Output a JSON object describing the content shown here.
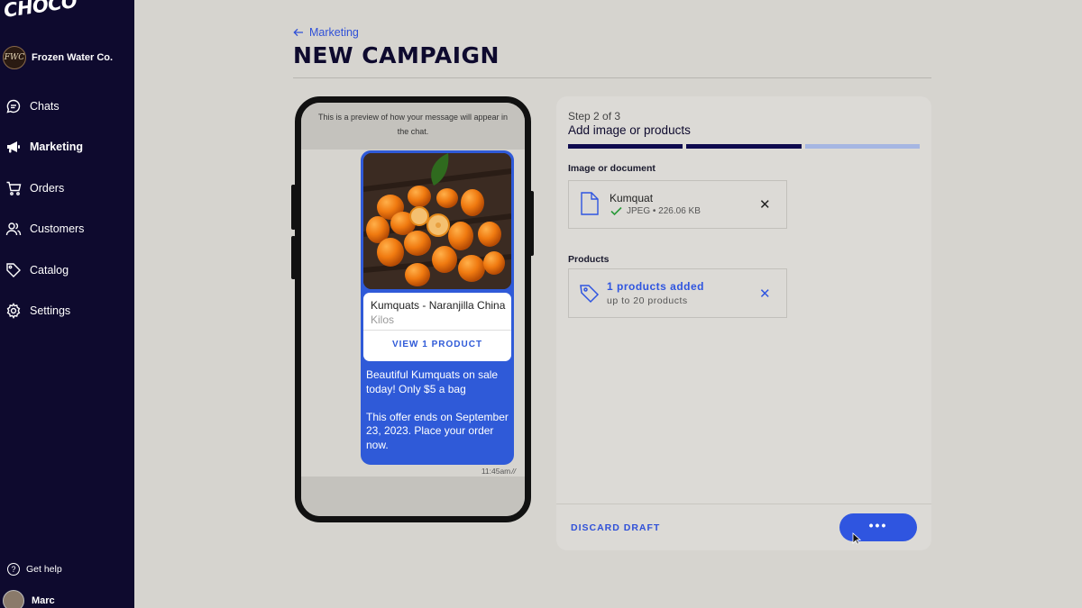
{
  "app": {
    "logo": "CHOCO"
  },
  "company": {
    "initials": "FWC",
    "name": "Frozen Water Co."
  },
  "nav": {
    "items": [
      {
        "label": "Chats",
        "icon": "chat-icon"
      },
      {
        "label": "Marketing",
        "icon": "megaphone-icon",
        "active": true
      },
      {
        "label": "Orders",
        "icon": "cart-icon"
      },
      {
        "label": "Customers",
        "icon": "users-icon"
      },
      {
        "label": "Catalog",
        "icon": "tag-icon"
      },
      {
        "label": "Settings",
        "icon": "gear-icon"
      }
    ],
    "help": "Get help",
    "user": "Marc"
  },
  "header": {
    "back_label": "Marketing",
    "title": "NEW CAMPAIGN"
  },
  "preview": {
    "notice": "This is a preview of how your message will appear in the chat.",
    "product_name": "Kumquats - Naranjilla China",
    "product_unit": "Kilos",
    "view_button": "VIEW 1 PRODUCT",
    "message_line1": "Beautiful Kumquats on sale today! Only $5 a bag",
    "message_line2": "This offer ends on September 23, 2023. Place your order now.",
    "time": "11:45am"
  },
  "wizard": {
    "step": "Step 2 of 3",
    "title": "Add image or products",
    "progress_completed_steps": 2,
    "progress_total_steps": 3,
    "image_section_label": "Image or document",
    "file_name": "Kumquat",
    "file_meta": "JPEG • 226.06 KB",
    "products_section_label": "Products",
    "products_added": "1 products added",
    "products_limit": "up to 20 products",
    "discard_label": "DISCARD DRAFT",
    "next_label": "•••"
  },
  "colors": {
    "sidebar": "#0e0a2e",
    "accent": "#2f55e0",
    "bubble": "#2f5ad8",
    "background": "#d6d4cf"
  }
}
